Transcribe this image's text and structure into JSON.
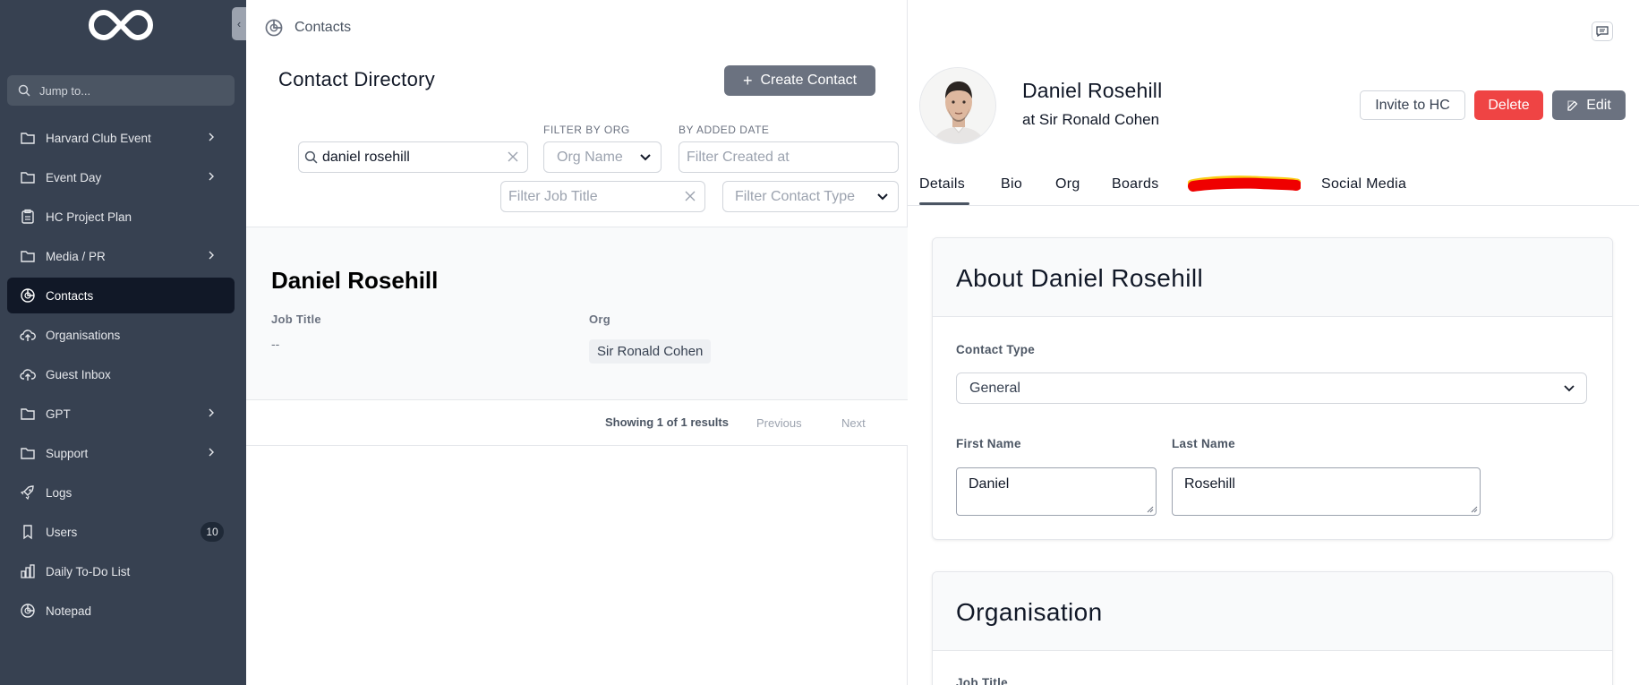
{
  "sidebar": {
    "jump_placeholder": "Jump to...",
    "items": [
      {
        "label": "Harvard Club Event",
        "icon": "folder-icon",
        "chevron": true
      },
      {
        "label": "Event Day",
        "icon": "folder-icon",
        "chevron": true
      },
      {
        "label": "HC Project Plan",
        "icon": "clipboard-icon",
        "chevron": false
      },
      {
        "label": "Media / PR",
        "icon": "folder-icon",
        "chevron": true
      },
      {
        "label": "Contacts",
        "icon": "pie-chart-icon",
        "active": true
      },
      {
        "label": "Organisations",
        "icon": "cloud-upload-icon"
      },
      {
        "label": "Guest Inbox",
        "icon": "cloud-upload-icon"
      },
      {
        "label": "GPT",
        "icon": "folder-icon",
        "chevron": true
      },
      {
        "label": "Support",
        "icon": "folder-icon",
        "chevron": true
      },
      {
        "label": "Logs",
        "icon": "rocket-icon"
      },
      {
        "label": "Users",
        "icon": "bookmark-icon",
        "badge": "10"
      },
      {
        "label": "Daily To-Do List",
        "icon": "bar-chart-icon"
      },
      {
        "label": "Notepad",
        "icon": "pie-chart-icon"
      }
    ]
  },
  "main": {
    "breadcrumb": "Contacts",
    "title": "Contact Directory",
    "create_label": "Create Contact",
    "filters": {
      "search_value": "daniel rosehill",
      "org_label": "FILTER BY ORG",
      "org_placeholder": "Org Name",
      "date_label": "BY ADDED DATE",
      "date_placeholder": "Filter Created at",
      "job_placeholder": "Filter Job Title",
      "type_placeholder": "Filter Contact Type"
    },
    "result": {
      "name": "Daniel Rosehill",
      "job_title_label": "Job Title",
      "job_title_value": "--",
      "org_label": "Org",
      "org_value": "Sir Ronald Cohen"
    },
    "pager": {
      "showing": "Showing 1 of 1 results",
      "previous": "Previous",
      "next": "Next"
    }
  },
  "detail": {
    "name": "Daniel Rosehill",
    "org_line": "at Sir Ronald Cohen",
    "invite_label": "Invite to HC",
    "delete_label": "Delete",
    "edit_label": "Edit",
    "tabs": [
      "Details",
      "Bio",
      "Org",
      "Boards",
      "Social Media"
    ],
    "about": {
      "title": "About Daniel Rosehill",
      "contact_type_label": "Contact Type",
      "contact_type_value": "General",
      "first_name_label": "First Name",
      "first_name_value": "Daniel",
      "last_name_label": "Last Name",
      "last_name_value": "Rosehill"
    },
    "organisation": {
      "title": "Organisation",
      "job_title_label": "Job Title"
    }
  },
  "colors": {
    "sidebar_bg": "#374151",
    "active_bg": "#111827",
    "delete": "#ef4444",
    "button_gray": "#6b7280"
  }
}
